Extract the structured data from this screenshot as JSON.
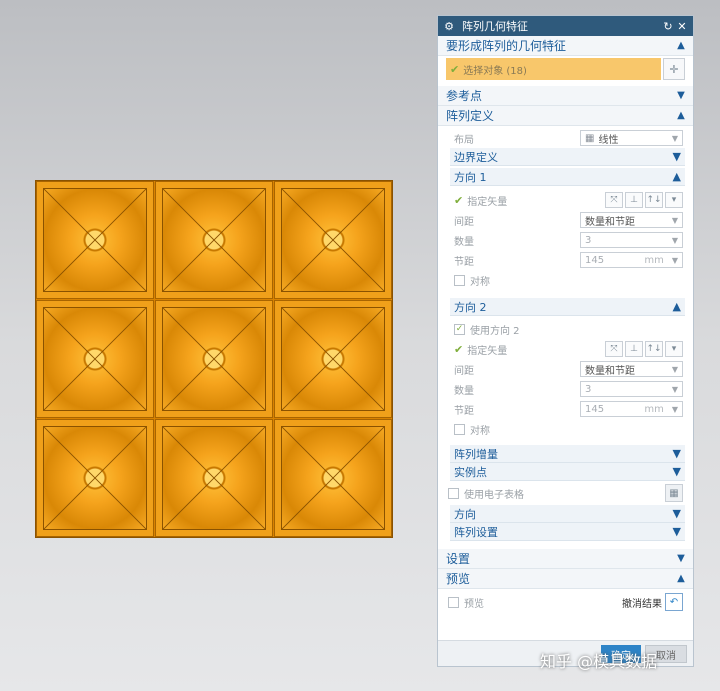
{
  "panel": {
    "title": "阵列几何特征",
    "sections": {
      "geom": "要形成阵列的几何特征",
      "refpoint": "参考点",
      "pattern_def": "阵列定义",
      "settings": "设置",
      "preview": "预览"
    },
    "select_object": "选择对象 (18)",
    "layout_label": "布局",
    "layout_value": "线性",
    "boundary": "边界定义",
    "dir1": {
      "title": "方向 1",
      "vector": "指定矢量",
      "spacing_label": "间距",
      "spacing_value": "数量和节距",
      "count_label": "数量",
      "count_value": "3",
      "pitch_label": "节距",
      "pitch_value": "145",
      "pitch_unit": "mm",
      "symmetric": "对称"
    },
    "dir2": {
      "title": "方向 2",
      "use": "使用方向 2",
      "vector": "指定矢量",
      "spacing_label": "间距",
      "spacing_value": "数量和节距",
      "count_label": "数量",
      "count_value": "3",
      "pitch_label": "节距",
      "pitch_value": "145",
      "pitch_unit": "mm",
      "symmetric": "对称"
    },
    "increment": "阵列增量",
    "instance": "实例点",
    "spreadsheet": "使用电子表格",
    "orientation": "方向",
    "pattern_settings": "阵列设置",
    "preview_chk": "预览",
    "undo_result": "撤消结果",
    "ok": "确定",
    "cancel": "取消"
  },
  "watermark": "知乎 @模具数据",
  "colors": {
    "accent": "#2f5a7c",
    "section_text": "#1d5d9a",
    "selection": "#f8c76b",
    "model": "#f0a01a"
  }
}
